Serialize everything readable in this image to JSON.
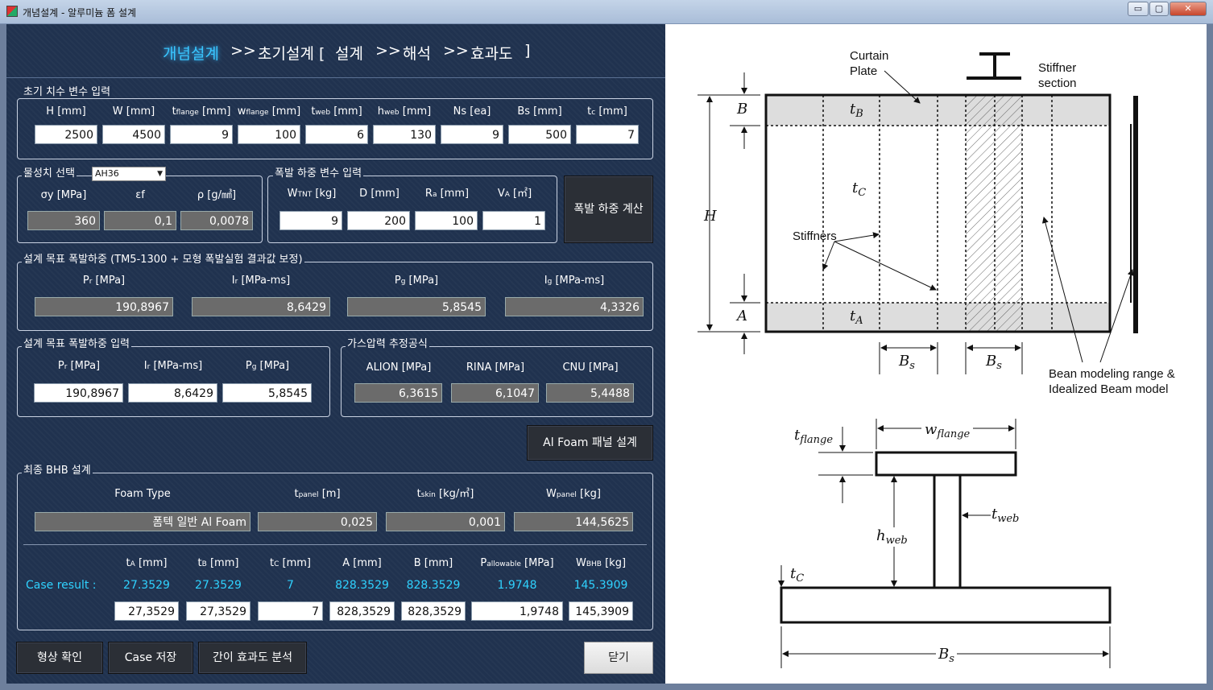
{
  "window": {
    "title": "개념설계 - 알루미늄 폼 설계",
    "min": "▭",
    "max": "▢",
    "close": "✕"
  },
  "nav": {
    "concept": "개념설계",
    "sep1": ">>",
    "initial": "초기설계 [",
    "design": "설계",
    "sep2": ">>",
    "analysis": "해석",
    "sep3": ">>",
    "effect": "효과도",
    "close_bracket": "]"
  },
  "initial_dims": {
    "title": "초기 치수 변수 입력",
    "labels": [
      {
        "main": "H",
        "sub": "",
        "unit": "[mm]"
      },
      {
        "main": "W",
        "sub": "",
        "unit": "[mm]"
      },
      {
        "main": "t",
        "sub": "flange",
        "unit": "[mm]"
      },
      {
        "main": "w",
        "sub": "flange",
        "unit": "[mm]"
      },
      {
        "main": "t",
        "sub": "web",
        "unit": "[mm]"
      },
      {
        "main": "h",
        "sub": "web",
        "unit": "[mm]"
      },
      {
        "main": "Ns",
        "sub": "",
        "unit": "[ea]"
      },
      {
        "main": "Bs",
        "sub": "",
        "unit": "[mm]"
      },
      {
        "main": "t",
        "sub": "c",
        "unit": "[mm]"
      }
    ],
    "values": [
      "2500",
      "4500",
      "9",
      "100",
      "6",
      "130",
      "9",
      "500",
      "7"
    ]
  },
  "material": {
    "title": "물성치 선택",
    "selected": "AH36",
    "arrow": "▼",
    "labels": [
      "σy [MPa]",
      "εf",
      "ρ [g/㎣]"
    ],
    "values": [
      "360",
      "0,1",
      "0,0078"
    ]
  },
  "blast": {
    "title": "폭발 하중 변수 입력",
    "labels": [
      {
        "main": "W",
        "sub": "TNT",
        "unit": "[kg]"
      },
      {
        "main": "D",
        "sub": "",
        "unit": "[mm]"
      },
      {
        "main": "R",
        "sub": "a",
        "unit": "[mm]"
      },
      {
        "main": "V",
        "sub": "A",
        "unit": "[㎡]"
      }
    ],
    "values": [
      "9",
      "200",
      "100",
      "1"
    ],
    "calc_button": "폭발 하중 계산"
  },
  "target": {
    "title": "설계 목표 폭발하중 (TM5-1300 + 모형 폭발실험 결과값 보정)",
    "labels": [
      {
        "main": "P",
        "sub": "r",
        "unit": "[MPa]"
      },
      {
        "main": "I",
        "sub": "r",
        "unit": "[MPa-ms]"
      },
      {
        "main": "P",
        "sub": "g",
        "unit": "[MPa]"
      },
      {
        "main": "I",
        "sub": "g",
        "unit": "[MPa-ms]"
      }
    ],
    "values": [
      "190,8967",
      "8,6429",
      "5,8545",
      "4,3326"
    ]
  },
  "target_input": {
    "title": "설계 목표 폭발하중 입력",
    "labels": [
      {
        "main": "P",
        "sub": "r",
        "unit": "[MPa]"
      },
      {
        "main": "I",
        "sub": "r",
        "unit": "[MPa-ms]"
      },
      {
        "main": "P",
        "sub": "g",
        "unit": "[MPa]"
      }
    ],
    "values": [
      "190,8967",
      "8,6429",
      "5,8545"
    ]
  },
  "gas": {
    "title": "가스압력 추정공식",
    "labels": [
      "ALION [MPa]",
      "RINA [MPa]",
      "CNU [MPa]"
    ],
    "values": [
      "6,3615",
      "6,1047",
      "5,4488"
    ]
  },
  "foam_button": "Al Foam 패널 설계",
  "bhb": {
    "title": "최종 BHB 설계",
    "labels": [
      {
        "main": "Foam Type",
        "sub": "",
        "unit": ""
      },
      {
        "main": "t",
        "sub": "panel",
        "unit": "[m]"
      },
      {
        "main": "t",
        "sub": "skin",
        "unit": "[kg/㎥]"
      },
      {
        "main": "W",
        "sub": "panel",
        "unit": "[kg]"
      }
    ],
    "values": [
      "폼텍 일반 Al Foam",
      "0,025",
      "0,001",
      "144,5625"
    ],
    "case_labels": [
      {
        "main": "t",
        "sub": "A",
        "unit": "[mm]"
      },
      {
        "main": "t",
        "sub": "B",
        "unit": "[mm]"
      },
      {
        "main": "t",
        "sub": "C",
        "unit": "[mm]"
      },
      {
        "main": "A",
        "sub": "",
        "unit": "[mm]"
      },
      {
        "main": "B",
        "sub": "",
        "unit": "[mm]"
      },
      {
        "main": "P",
        "sub": "allowable",
        "unit": "[MPa]"
      },
      {
        "main": "W",
        "sub": "BHB",
        "unit": "[kg]"
      }
    ],
    "case_result_label": "Case result :",
    "case_results": [
      "27.3529",
      "27.3529",
      "7",
      "828.3529",
      "828.3529",
      "1.9748",
      "145.3909"
    ],
    "case_values": [
      "27,3529",
      "27,3529",
      "7",
      "828,3529",
      "828,3529",
      "1,9748",
      "145,3909"
    ]
  },
  "buttons": {
    "shape": "형상 확인",
    "save": "Case 저장",
    "effect": "간이 효과도 분석",
    "close": "닫기"
  },
  "diagram": {
    "curtain": "Curtain",
    "plate": "Plate",
    "stiffner": "Stiffner",
    "section": "section",
    "stiffners": "Stiffners",
    "bean1": "Bean modeling range &",
    "bean2": "Idealized Beam model",
    "B": "B",
    "H": "H",
    "A": "A",
    "t": "t",
    "tB": "B",
    "tC": "C",
    "tA": "A",
    "Bs": "B",
    "s": "s",
    "tflange": "flange",
    "wflange": "flange",
    "w": "w",
    "tweb": "web",
    "h": "h",
    "hweb": "web",
    "tc": "C"
  }
}
